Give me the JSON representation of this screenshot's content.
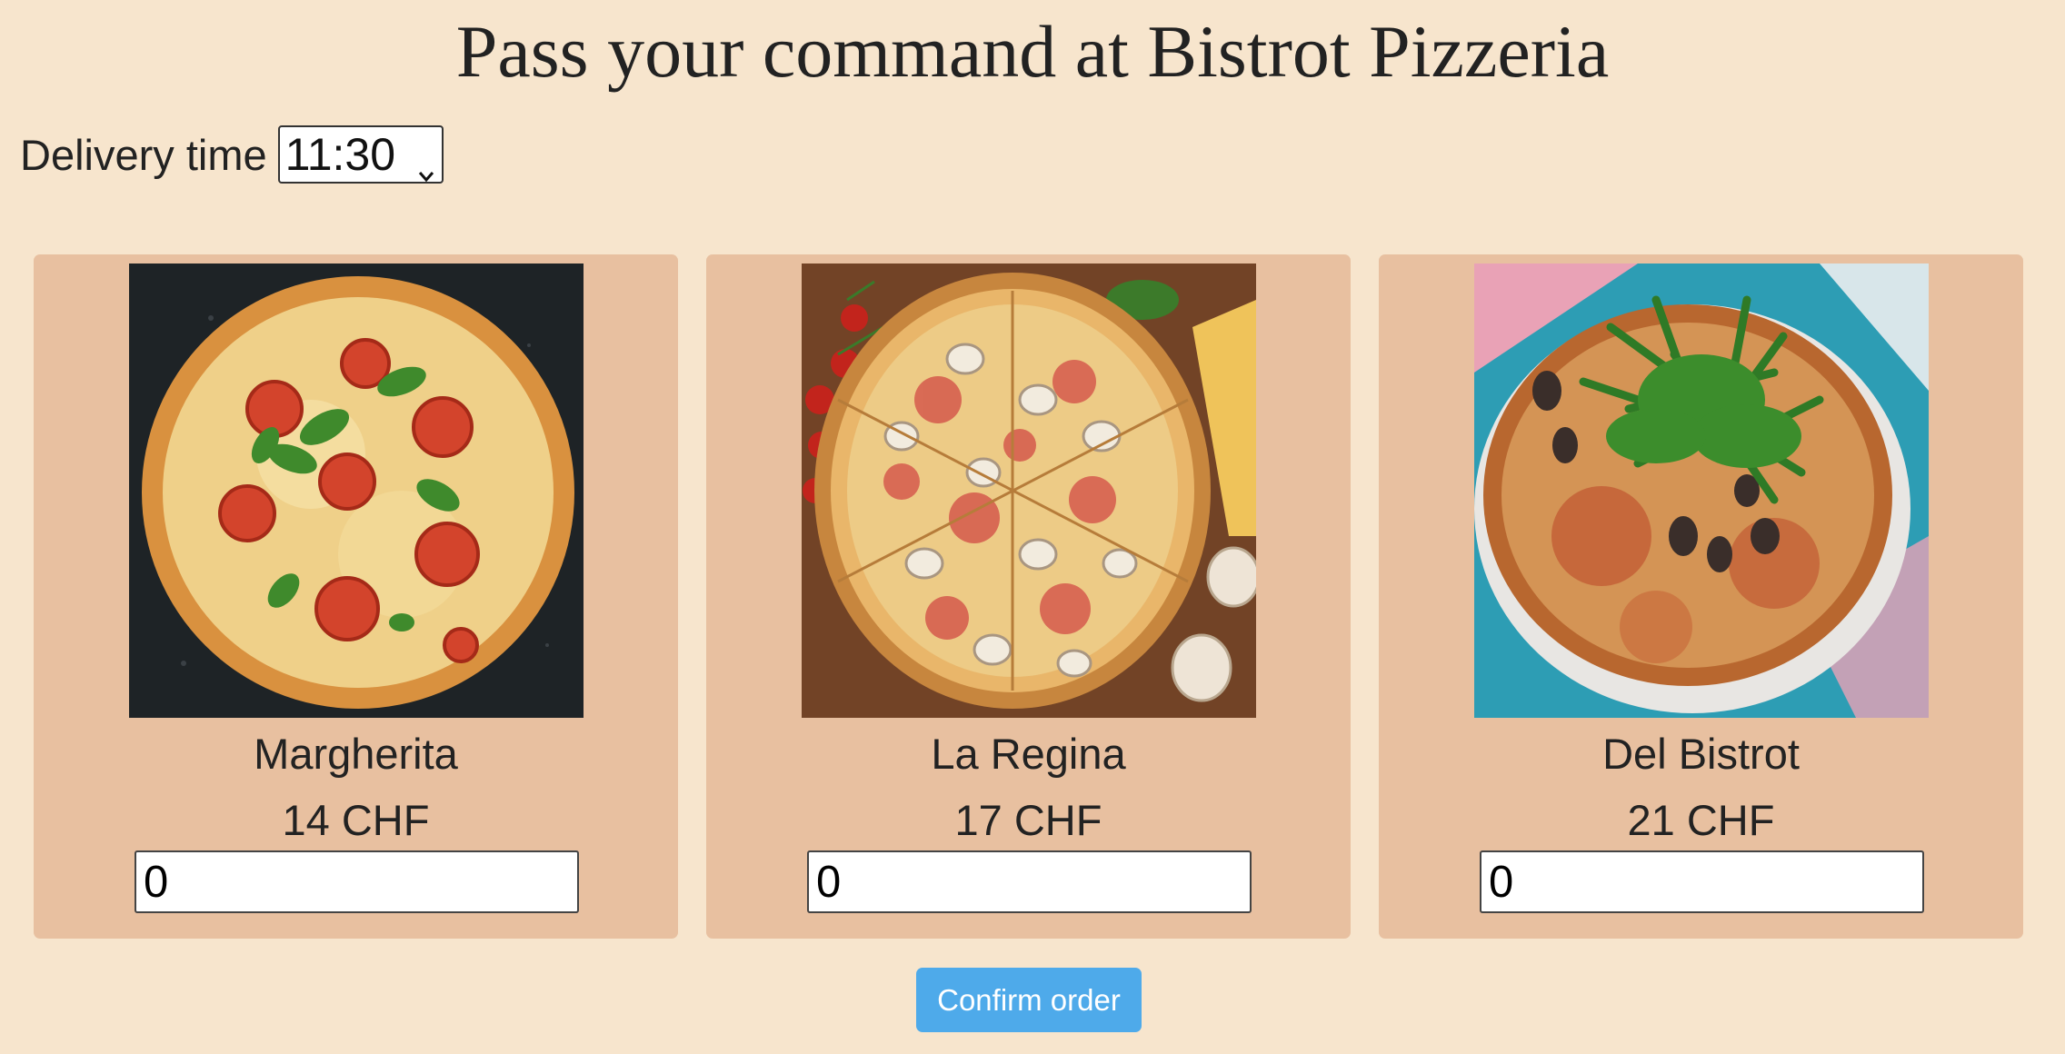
{
  "page": {
    "title": "Pass your command at Bistrot Pizzeria"
  },
  "delivery": {
    "label": "Delivery time",
    "selected": "11:30"
  },
  "pizzas": [
    {
      "name": "Margherita",
      "price": "14 CHF",
      "quantity": "0",
      "image_icon": "margherita-pizza-photo"
    },
    {
      "name": "La Regina",
      "price": "17 CHF",
      "quantity": "0",
      "image_icon": "la-regina-pizza-photo"
    },
    {
      "name": "Del Bistrot",
      "price": "21 CHF",
      "quantity": "0",
      "image_icon": "del-bistrot-pizza-photo"
    }
  ],
  "actions": {
    "confirm_label": "Confirm order"
  },
  "colors": {
    "background": "#f7e5cd",
    "card": "#e8c0a0",
    "button": "#4eaaea"
  }
}
